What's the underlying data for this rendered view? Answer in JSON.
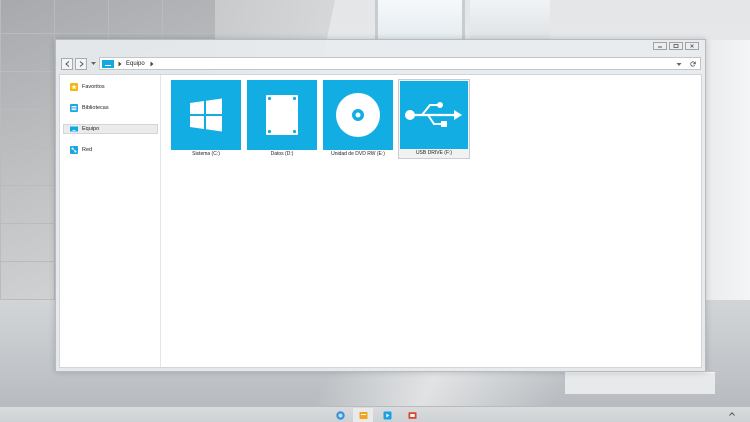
{
  "window": {
    "address": {
      "location": "Equipo",
      "icons": {
        "back": "back-arrow-icon",
        "forward": "forward-arrow-icon",
        "recent": "chevron-down-icon",
        "location": "computer-icon",
        "separator": "chevron-right-icon",
        "history": "chevron-down-icon",
        "refresh": "refresh-icon"
      }
    },
    "caption_buttons": [
      "minimize-icon",
      "maximize-icon",
      "close-icon"
    ]
  },
  "sidebar": {
    "items": [
      {
        "label": "Favoritos",
        "icon": "star-icon",
        "selected": false
      },
      {
        "label": "Bibliotecas",
        "icon": "library-icon",
        "selected": false
      },
      {
        "label": "Equipo",
        "icon": "computer-icon",
        "selected": true
      },
      {
        "label": "Red",
        "icon": "network-icon",
        "selected": false
      }
    ]
  },
  "drives": [
    {
      "label": "Sistema (C:)",
      "icon": "windows-logo-icon"
    },
    {
      "label": "Datos (D:)",
      "icon": "hard-drive-icon"
    },
    {
      "label": "Unidad de DVD RW (E:)",
      "icon": "disc-icon"
    },
    {
      "label": "USB DRIVE (F:)",
      "icon": "usb-icon",
      "selected": true
    }
  ],
  "taskbar": {
    "items": [
      {
        "icon": "start-icon",
        "color": "#3a8fd9"
      },
      {
        "icon": "folder-icon",
        "color": "#f3a41b",
        "active": true
      },
      {
        "icon": "media-player-icon",
        "color": "#1aa0e6"
      },
      {
        "icon": "presentation-icon",
        "color": "#d9452b"
      }
    ],
    "tray": "chevron-up-icon"
  },
  "colors": {
    "tile_accent": "#12aee3",
    "window_frame": "#e8ebee",
    "content_background": "#ffffff"
  }
}
